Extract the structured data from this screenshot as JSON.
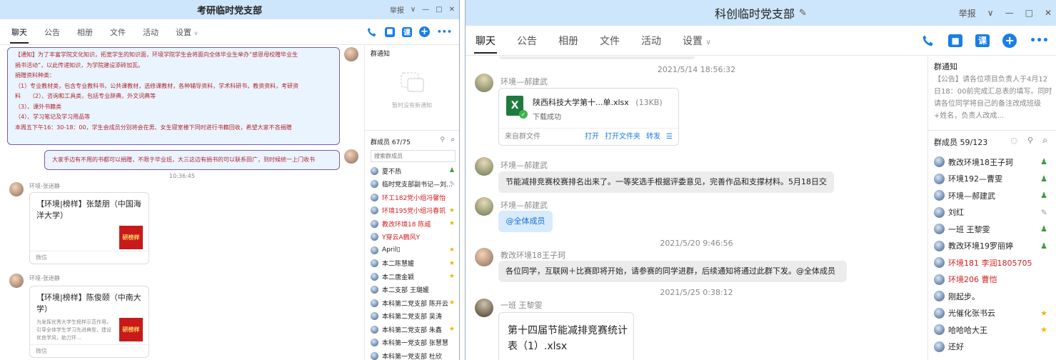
{
  "left": {
    "title": "考研临时党支部",
    "controls": {
      "report": "举报",
      "chev": "∨",
      "min": "—",
      "max": "□",
      "close": "✕"
    },
    "tabs": [
      "聊天",
      "公告",
      "相册",
      "文件",
      "活动",
      "设置"
    ],
    "settings_chevron": "∨",
    "video_box": "■",
    "ke_box": "课",
    "plus": "+",
    "more": "•••",
    "notice_lines": [
      "【通知】为了丰富学院文化知识，拓宽学生的知识面，环境学院学生会将面向全体毕业生举办“感恩母校赠毕业生",
      "捐书活动”，以此传递知识，为学院建设添砖加瓦。",
      "捐赠资料种类：",
      "（1）专业教材类，包含专业教科书，公共课教材，选修课教材，各种辅导资料，学术科研书，教资资料，考研资",
      "料　　（2）、咨询和工具类，包括专业辞典，外文词典等",
      "（3）、课外书籍类",
      "（4）、学习笔记及学习用品等",
      "本周五下午16：30-18：00，学生会成员分别将会在男、女生寝室楼下同时进行书籍回收，希望大家不吝捐赠"
    ],
    "notice2": "大家手边有不用的书都可以捐赠，不限于毕业班，大三这边有捐书的可以联系田广，到时候统一上门收书",
    "time1": "10:36:45",
    "msgs": [
      {
        "sender": "环境-张迷静",
        "card_title": "【环境|榜样】张楚朋（中国海洋大学）",
        "card_desc": "",
        "card_img": "研榜样",
        "source": "微信"
      },
      {
        "sender": "环境-张迷静",
        "card_title": "【环境|榜样】陈俊颐（中南大学）",
        "card_desc": "为发挥优秀大学生榜样示范作用，引导全体学生学习先进典型，建设优良学风，助力环...",
        "card_img": "研榜样",
        "source": "微信"
      }
    ],
    "side": {
      "notice_title": "群通知",
      "notice_empty": "暂时没有新通知",
      "members_title": "群成员 67/75",
      "search_placeholder": "搜索群成员",
      "members": [
        {
          "name": "夏不热",
          "color": "#222",
          "mark": "person"
        },
        {
          "name": "临时党支部副书记—刘...",
          "color": "#222",
          "mark": "edit"
        },
        {
          "name": "环工182党小组冯馨怡",
          "color": "#d42020",
          "mark": ""
        },
        {
          "name": "环境195党小组冯春凯",
          "color": "#d42020",
          "mark": "star"
        },
        {
          "name": "教改环境18 陈威",
          "color": "#d42020",
          "mark": "star"
        },
        {
          "name": "Y穿云A鶴风Y",
          "color": "#d42020",
          "mark": ""
        },
        {
          "name": "April▯",
          "color": "#222",
          "mark": "star"
        },
        {
          "name": "本二陈慧媛",
          "color": "#222",
          "mark": "star"
        },
        {
          "name": "本二唐金颖",
          "color": "#222",
          "mark": "star"
        },
        {
          "name": "本二支部 王璐媛",
          "color": "#222",
          "mark": ""
        },
        {
          "name": "本科第二党支部 陈开云",
          "color": "#222",
          "mark": "star"
        },
        {
          "name": "本科第二党支部 吴涛",
          "color": "#222",
          "mark": ""
        },
        {
          "name": "本科第二党支部 朱鑫",
          "color": "#222",
          "mark": "star"
        },
        {
          "name": "本科第一党支部 张慧慧",
          "color": "#222",
          "mark": ""
        },
        {
          "name": "本科第一党支部 杜欣",
          "color": "#222",
          "mark": ""
        }
      ]
    }
  },
  "right": {
    "title": "科创临时党支部",
    "controls": {
      "report": "举报",
      "chev": "∨",
      "min": "—",
      "max": "□",
      "close": "✕"
    },
    "tabs": [
      "聊天",
      "公告",
      "相册",
      "文件",
      "活动",
      "设置"
    ],
    "settings_chevron": "∨",
    "video_box": "■",
    "ke_box": "课",
    "plus": "+",
    "more": "•••",
    "edit_icon": "✎",
    "time1": "2021/5/14 18:56:32",
    "sender1": "环境—郝建武",
    "file_name": "陕西科技大学第十...单.xlsx",
    "file_size": "(13KB)",
    "file_status": "下载成功",
    "file_from": "来自群文件",
    "file_open": "打开",
    "file_open_folder": "打开文件夹",
    "file_forward": "转发",
    "sender2": "环境—郝建武",
    "msg2": "节能减排竞赛校赛排名出来了。一等奖选手根据评委意见，完善作品和支撑材料。5月18日交",
    "sender3": "环境—郝建武",
    "msg3": "@全体成员",
    "time2": "2021/5/20 9:46:56",
    "sender4": "教改环境18王子珂",
    "msg4": "各位同学，互联网＋比赛即将开始，请参赛的同学进群，后续通知将通过此群下发。@全体成员",
    "time3": "2021/5/25 0:38:12",
    "sender5": "一班 王黎雯",
    "card5": "第十四届节能减排竞赛统计表（1）.xlsx",
    "side": {
      "notice_title": "群通知",
      "notice_text": "【公告】请各位项目负责人于4月12日18：00前完成汇总表的填写。同时请各位同学将自己的备注改成班级+姓名，负责人改成...",
      "members_title": "群成员 59/123",
      "members": [
        {
          "name": "教改环境18王子珂",
          "color": "#222",
          "mark": "person"
        },
        {
          "name": "环境192—曹雯",
          "color": "#222",
          "mark": "person"
        },
        {
          "name": "环境—郝建武",
          "color": "#222",
          "mark": "person"
        },
        {
          "name": "刘红",
          "color": "#222",
          "mark": "edit"
        },
        {
          "name": "一班 王黎雯",
          "color": "#222",
          "mark": "person"
        },
        {
          "name": "教改环境19罗丽婷",
          "color": "#222",
          "mark": "person"
        },
        {
          "name": "环境181 李润1805705",
          "color": "#d42020",
          "mark": ""
        },
        {
          "name": "环境206 曹恺",
          "color": "#d42020",
          "mark": ""
        },
        {
          "name": "刚起步。",
          "color": "#222",
          "mark": ""
        },
        {
          "name": "光催化张书云",
          "color": "#222",
          "mark": "star"
        },
        {
          "name": "哈哈哈大王",
          "color": "#222",
          "mark": "star"
        },
        {
          "name": "还好",
          "color": "#222",
          "mark": ""
        }
      ]
    }
  }
}
